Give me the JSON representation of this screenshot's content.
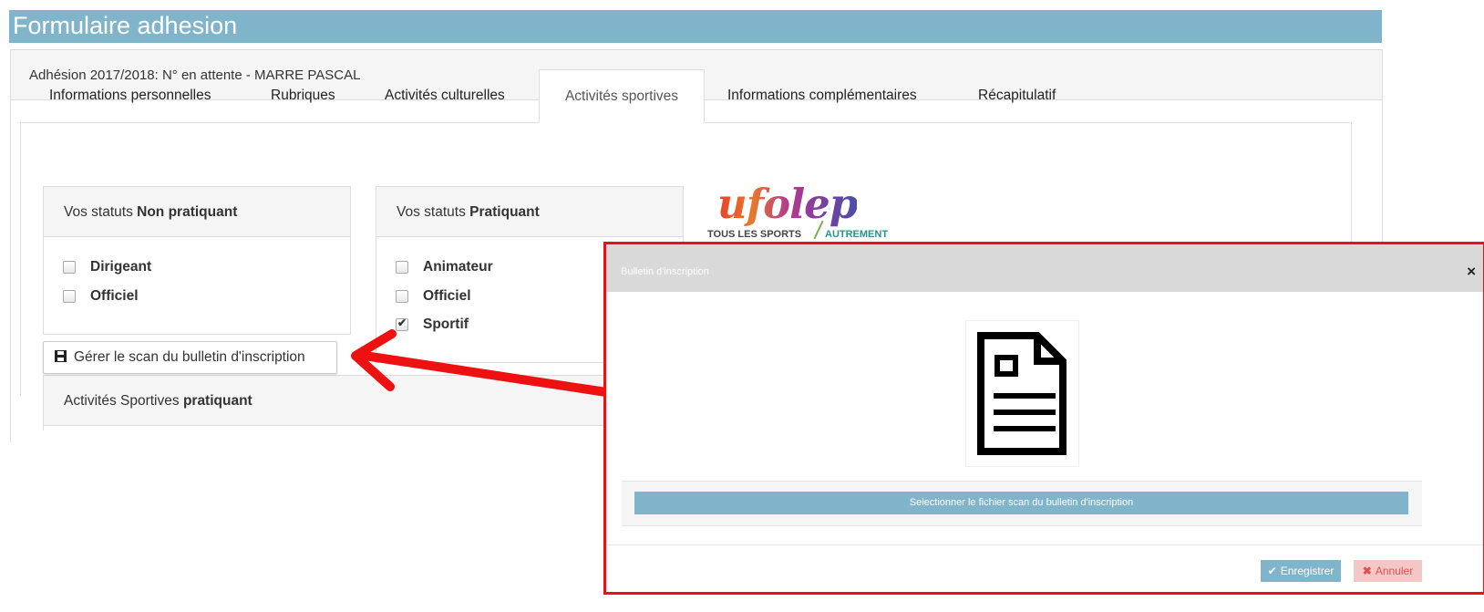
{
  "header": {
    "title": "Formulaire adhesion"
  },
  "panel": {
    "heading": "Adhésion 2017/2018: N° en attente - MARRE PASCAL"
  },
  "tabs": [
    {
      "label": "Informations personnelles"
    },
    {
      "label": "Rubriques"
    },
    {
      "label": "Activités culturelles"
    },
    {
      "label": "Activités sportives"
    },
    {
      "label": "Informations complémentaires"
    },
    {
      "label": "Récapitulatif"
    }
  ],
  "non_pratiquant": {
    "heading_prefix": "Vos statuts ",
    "heading_bold": "Non pratiquant",
    "items": [
      {
        "label": "Dirigeant",
        "checked": false
      },
      {
        "label": "Officiel",
        "checked": false
      }
    ]
  },
  "pratiquant": {
    "heading_prefix": "Vos statuts ",
    "heading_bold": "Pratiquant",
    "items": [
      {
        "label": "Animateur",
        "checked": false
      },
      {
        "label": "Officiel",
        "checked": false
      },
      {
        "label": "Sportif",
        "checked": true
      }
    ]
  },
  "scan_button": {
    "label": "Gérer le scan du bulletin d'inscription",
    "icon": "floppy-disk-icon"
  },
  "activities_box": {
    "heading_prefix": "Activités Sportives ",
    "heading_bold": "pratiquant"
  },
  "logo": {
    "word": "ufolep",
    "tagline_left": "TOUS LES SPORTS",
    "tagline_right": "AUTREMENT"
  },
  "modal": {
    "title": "Bulletin d'inscription",
    "close": "×",
    "select_label": "Selectionner le fichier scan du bulletin d'inscription",
    "save_label": "Enregistrer",
    "cancel_label": "Annuler"
  },
  "colors": {
    "accent": "#7fb4cb",
    "annotation_red": "#ee1111",
    "cancel_bg": "#f5c6c6",
    "cancel_text": "#d9534f"
  }
}
